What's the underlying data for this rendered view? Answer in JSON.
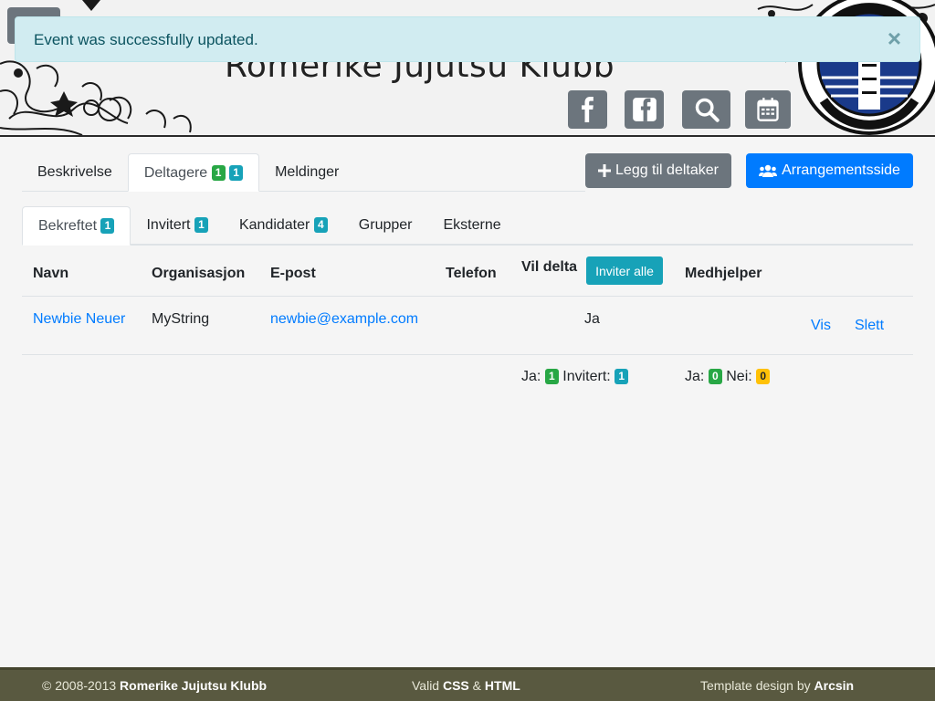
{
  "alert": {
    "message": "Event was successfully updated.",
    "close": "×"
  },
  "site": {
    "title": "Romerike Jujutsu Klubb"
  },
  "header_buttons": [
    "facebook-icon",
    "facebook-square-icon",
    "search-icon",
    "calendar-icon"
  ],
  "tabs_top": {
    "description": "Beskrivelse",
    "participants": "Deltagere",
    "participants_badge_green": "1",
    "participants_badge_teal": "1",
    "messages": "Meldinger"
  },
  "actions": {
    "add_participant": "Legg til deltaker",
    "event_page": "Arrangementsside"
  },
  "tabs_sub": {
    "confirmed": "Bekreftet",
    "confirmed_count": "1",
    "invited": "Invitert",
    "invited_count": "1",
    "candidates": "Kandidater",
    "candidates_count": "4",
    "groups": "Grupper",
    "external": "Eksterne"
  },
  "table": {
    "headers": {
      "name": "Navn",
      "organization": "Organisasjon",
      "email": "E-post",
      "phone": "Telefon",
      "attending": "Vil delta",
      "invite_all": "Inviter alle",
      "helper": "Medhjelper"
    },
    "rows": [
      {
        "name": "Newbie Neuer",
        "organization": "MyString",
        "email": "newbie@example.com",
        "phone": "",
        "attending": "Ja",
        "show": "Vis",
        "delete": "Slett"
      }
    ],
    "summary": {
      "yes_label": "Ja:",
      "yes_count": "1",
      "invited_label": "Invitert:",
      "invited_count": "1",
      "helper_yes_label": "Ja:",
      "helper_yes_count": "0",
      "helper_no_label": "Nei:",
      "helper_no_count": "0"
    }
  },
  "footer": {
    "copyright_prefix": "© 2008-2013 ",
    "club": "Romerike Jujutsu Klubb",
    "valid_prefix": "Valid ",
    "css": "CSS",
    "amp": " & ",
    "html": "HTML",
    "template_prefix": "Template design by ",
    "designer": "Arcsin"
  },
  "colors": {
    "primary": "#007bff",
    "secondary": "#6c757d",
    "info": "#17a2b8",
    "success": "#28a745",
    "warning": "#ffc107",
    "footer": "#595940"
  }
}
